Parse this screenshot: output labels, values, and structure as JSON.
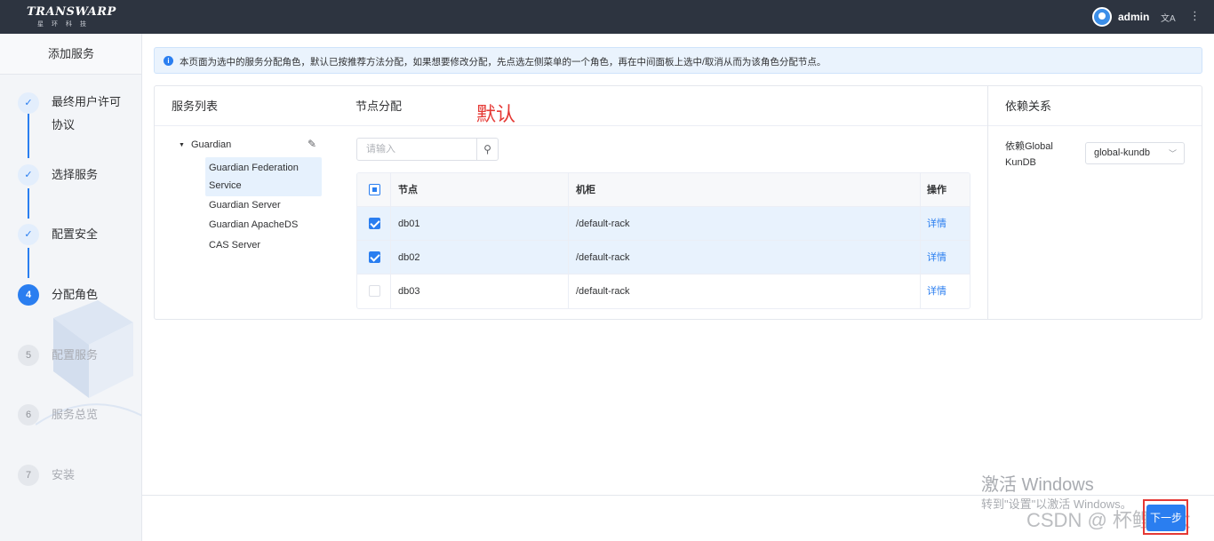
{
  "topbar": {
    "brand": "TRANSWARP",
    "brand_sub": "星环科技",
    "user": "admin",
    "lang_icon": "translate-icon",
    "more_icon": "more-vertical-icon"
  },
  "sidebar": {
    "title": "添加服务",
    "steps": [
      {
        "num": "✓",
        "label": "最终用户许可协议",
        "status": "done"
      },
      {
        "num": "✓",
        "label": "选择服务",
        "status": "done"
      },
      {
        "num": "✓",
        "label": "配置安全",
        "status": "done"
      },
      {
        "num": "4",
        "label": "分配角色",
        "status": "active"
      },
      {
        "num": "5",
        "label": "配置服务",
        "status": "todo"
      },
      {
        "num": "6",
        "label": "服务总览",
        "status": "todo"
      },
      {
        "num": "7",
        "label": "安装",
        "status": "todo"
      }
    ]
  },
  "info": {
    "text": "本页面为选中的服务分配角色，默认已按推荐方法分配，如果想要修改分配，先点选左侧菜单的一个角色，再在中间面板上选中/取消从而为该角色分配节点。"
  },
  "service_list": {
    "title": "服务列表",
    "root": "Guardian",
    "children": [
      "Guardian Federation Service",
      "Guardian Server",
      "Guardian ApacheDS",
      "CAS Server"
    ]
  },
  "node_assign": {
    "title": "节点分配",
    "annotation": "默认",
    "search_placeholder": "请输入",
    "columns": {
      "node": "节点",
      "rack": "机柜",
      "op": "操作"
    },
    "rows": [
      {
        "node": "db01",
        "rack": "/default-rack",
        "op": "详情",
        "checked": true
      },
      {
        "node": "db02",
        "rack": "/default-rack",
        "op": "详情",
        "checked": true
      },
      {
        "node": "db03",
        "rack": "/default-rack",
        "op": "详情",
        "checked": false
      }
    ]
  },
  "dependency": {
    "title": "依赖关系",
    "label": "依赖Global KunDB",
    "selected": "global-kundb"
  },
  "footer": {
    "watermark_title": "激活 Windows",
    "watermark_sub": "转到\"设置\"以激活 Windows。",
    "csdn": "CSDN @ 杯鲤伟大",
    "next_label": "下一步"
  },
  "colors": {
    "accent": "#2a7ef0",
    "topbar": "#2d3440",
    "annotation": "#e53935"
  }
}
